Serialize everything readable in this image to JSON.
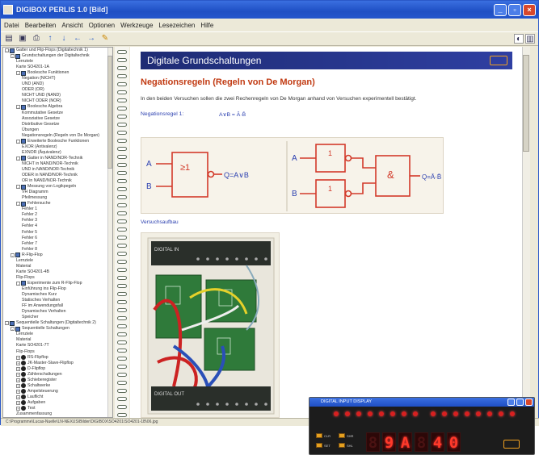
{
  "window": {
    "title": "DIGIBOX PERLIS 1.0 [Bild]",
    "menu": [
      "Datei",
      "Bearbeiten",
      "Ansicht",
      "Optionen",
      "Werkzeuge",
      "Lesezeichen",
      "Hilfe"
    ]
  },
  "tree": {
    "items": [
      {
        "label": "Gatter und Flip-Flops (Digitaltechnik 1)",
        "level": 0,
        "icon": "book",
        "exp": "-"
      },
      {
        "label": "Grundschaltungen der Digitaltechnik",
        "level": 1,
        "icon": "book",
        "exp": "-"
      },
      {
        "label": "Lernziele",
        "level": 2,
        "icon": "page"
      },
      {
        "label": "Karte SO4201-1A",
        "level": 2,
        "icon": "page"
      },
      {
        "label": "Boolesche Funktionen",
        "level": 2,
        "icon": "book",
        "exp": "-"
      },
      {
        "label": "Negation (NICHT)",
        "level": 3,
        "icon": "page"
      },
      {
        "label": "UND (AND)",
        "level": 3,
        "icon": "page"
      },
      {
        "label": "ODER (OR)",
        "level": 3,
        "icon": "page"
      },
      {
        "label": "NICHT UND (NAND)",
        "level": 3,
        "icon": "page"
      },
      {
        "label": "NICHT ODER (NOR)",
        "level": 3,
        "icon": "page"
      },
      {
        "label": "Boolesche Algebra",
        "level": 2,
        "icon": "book",
        "exp": "-"
      },
      {
        "label": "Kommutative Gesetze",
        "level": 3,
        "icon": "page"
      },
      {
        "label": "Assoziative Gesetze",
        "level": 3,
        "icon": "page"
      },
      {
        "label": "Distributive Gesetze",
        "level": 3,
        "icon": "page"
      },
      {
        "label": "Übungen",
        "level": 3,
        "icon": "page"
      },
      {
        "label": "Negationsregeln (Regeln von De Morgan)",
        "level": 3,
        "icon": "page"
      },
      {
        "label": "Erweiterte Boolesche Funktionen",
        "level": 2,
        "icon": "book",
        "exp": "-"
      },
      {
        "label": "EXOR (Antivalenz)",
        "level": 3,
        "icon": "page"
      },
      {
        "label": "EXNOR (Äquivalenz)",
        "level": 3,
        "icon": "page"
      },
      {
        "label": "Gatter in NAND/NOR-Technik",
        "level": 2,
        "icon": "book",
        "exp": "-"
      },
      {
        "label": "NICHT in NAND/NOR-Technik",
        "level": 3,
        "icon": "page"
      },
      {
        "label": "UND in NAND/NOR-Technik",
        "level": 3,
        "icon": "page"
      },
      {
        "label": "ODER in NAND/NOR-Technik",
        "level": 3,
        "icon": "page"
      },
      {
        "label": "OR in NAND/NOR-Technik",
        "level": 3,
        "icon": "page"
      },
      {
        "label": "Messung von Logikpegeln",
        "level": 2,
        "icon": "book",
        "exp": "-"
      },
      {
        "label": "VH Diagramm",
        "level": 3,
        "icon": "page"
      },
      {
        "label": "Pfeilmessung",
        "level": 3,
        "icon": "page"
      },
      {
        "label": "Fehlersuche",
        "level": 2,
        "icon": "book",
        "exp": "-"
      },
      {
        "label": "Fehler 1",
        "level": 3,
        "icon": "page"
      },
      {
        "label": "Fehler 2",
        "level": 3,
        "icon": "page"
      },
      {
        "label": "Fehler 3",
        "level": 3,
        "icon": "page"
      },
      {
        "label": "Fehler 4",
        "level": 3,
        "icon": "page"
      },
      {
        "label": "Fehler 5",
        "level": 3,
        "icon": "page"
      },
      {
        "label": "Fehler 6",
        "level": 3,
        "icon": "page"
      },
      {
        "label": "Fehler 7",
        "level": 3,
        "icon": "page"
      },
      {
        "label": "Fehler 8",
        "level": 3,
        "icon": "page"
      },
      {
        "label": "R-Flip-Flop",
        "level": 1,
        "icon": "book",
        "exp": "-"
      },
      {
        "label": "Lernziele",
        "level": 2,
        "icon": "page"
      },
      {
        "label": "Material",
        "level": 2,
        "icon": "page"
      },
      {
        "label": "Karte SO4201-4B",
        "level": 2,
        "icon": "page"
      },
      {
        "label": "Flip-Flops",
        "level": 2,
        "icon": "page"
      },
      {
        "label": "Experimente zum R-Flip-Flop",
        "level": 2,
        "icon": "book",
        "exp": "-"
      },
      {
        "label": "Einführung ins Flip-Flop",
        "level": 3,
        "icon": "page"
      },
      {
        "label": "Dynamisches Kurz",
        "level": 3,
        "icon": "page"
      },
      {
        "label": "Statisches Verhalten",
        "level": 3,
        "icon": "page"
      },
      {
        "label": "FF im Anwendungsfall",
        "level": 3,
        "icon": "page"
      },
      {
        "label": "Dynamisches Verhalten",
        "level": 3,
        "icon": "page"
      },
      {
        "label": "Speicher",
        "level": 3,
        "icon": "page"
      },
      {
        "label": "Sequentielle Schaltungen (Digitaltechnik 2)",
        "level": 0,
        "icon": "book",
        "exp": "-"
      },
      {
        "label": "Sequentielle Schaltungen",
        "level": 1,
        "icon": "book",
        "exp": "-"
      },
      {
        "label": "Lernziele",
        "level": 2,
        "icon": "page"
      },
      {
        "label": "Material",
        "level": 2,
        "icon": "page"
      },
      {
        "label": "Karte SO4201-7T",
        "level": 2,
        "icon": "page"
      },
      {
        "label": "Flip-Flops",
        "level": 2,
        "icon": "page"
      },
      {
        "label": "RS-Flipflop",
        "level": 2,
        "icon": "dot",
        "exp": "+"
      },
      {
        "label": "JK-Master-Slave-Flipflop",
        "level": 2,
        "icon": "dot",
        "exp": "+"
      },
      {
        "label": "D-Flipflop",
        "level": 2,
        "icon": "dot",
        "exp": "+"
      },
      {
        "label": "Zählerschaltungen",
        "level": 2,
        "icon": "dot",
        "exp": "+"
      },
      {
        "label": "Schieberegister",
        "level": 2,
        "icon": "dot",
        "exp": "+"
      },
      {
        "label": "Schaltwerke",
        "level": 2,
        "icon": "dot",
        "exp": "+"
      },
      {
        "label": "Ampelsteuerung",
        "level": 2,
        "icon": "dot",
        "exp": "+"
      },
      {
        "label": "Lauflicht",
        "level": 2,
        "icon": "dot",
        "exp": "+"
      },
      {
        "label": "Aufgaben",
        "level": 2,
        "icon": "dot",
        "exp": "+"
      },
      {
        "label": "Test",
        "level": 2,
        "icon": "dot",
        "exp": "+"
      },
      {
        "label": "Zusammenfassung",
        "level": 2,
        "icon": "page"
      }
    ]
  },
  "page": {
    "banner": "Digitale Grundschaltungen",
    "heading": "Negationsregeln (Regeln von De Morgan)",
    "intro": "In den beiden Versuchen sollen die zwei Rechenregeln von De Morgan anhand von Versuchen experimentell bestätigt.",
    "rule_label": "Negationsregel 1:",
    "rule_formula": "A∨B = Ā·B̄",
    "gates": {
      "left": {
        "inA": "A",
        "inB": "B",
        "symbol": "≥1",
        "out": "Q=A∨B"
      },
      "right": {
        "inA": "A",
        "inB": "B",
        "not1": "1",
        "not2": "1",
        "and": "&",
        "out": "Q=Ā·B̄"
      }
    },
    "setup_label": "Versuchsaufbau",
    "board": {
      "top": "DIGITAL IN",
      "bottom": "DIGITAL OUT"
    }
  },
  "statusbar": "C:\\Programme\\Lucas-Nuelle\\LN-NEXUS\\Bilder\\DIGIBOX\\SO4201\\SO4201-1B\\06.jpg",
  "device": {
    "title": "DIGITAL INPUT DISPLAY",
    "display": [
      "",
      "9",
      "A",
      "",
      "4",
      "0"
    ],
    "labels": [
      "CLR",
      "SET",
      "SHR",
      "SHL"
    ]
  }
}
